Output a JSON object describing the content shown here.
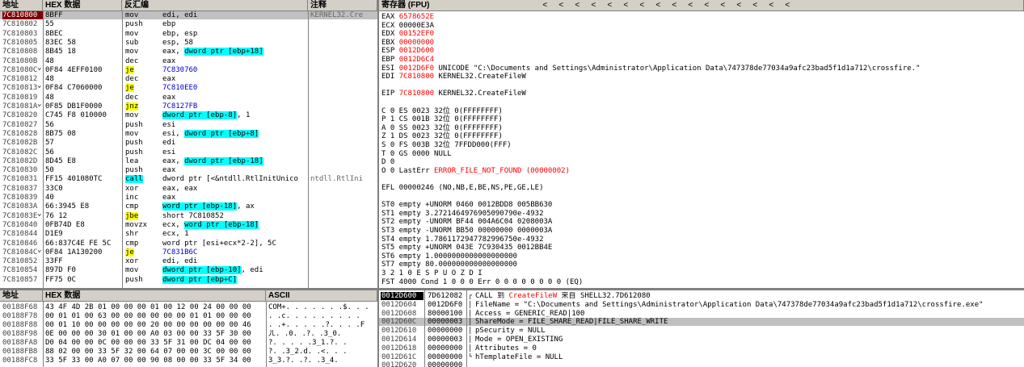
{
  "disasm": {
    "headers": {
      "addr": "地址",
      "hex": "HEX 数据",
      "asm": "反汇编",
      "comment": "注释"
    },
    "rows": [
      {
        "addr": "7C810800",
        "hex": "8BFF",
        "asm": [
          [
            "mov",
            ""
          ],
          [
            "edi, edi",
            ""
          ]
        ],
        "comment": "KERNEL32.Cre",
        "sel": true
      },
      {
        "addr": "7C810802",
        "hex": "55",
        "asm": [
          [
            "push",
            ""
          ],
          [
            "ebp",
            ""
          ]
        ],
        "comment": ""
      },
      {
        "addr": "7C810803",
        "hex": "8BEC",
        "asm": [
          [
            "mov",
            ""
          ],
          [
            "ebp, esp",
            ""
          ]
        ],
        "comment": ""
      },
      {
        "addr": "7C810805",
        "hex": "83EC 58",
        "asm": [
          [
            "sub",
            ""
          ],
          [
            "esp, 58",
            ""
          ]
        ],
        "comment": ""
      },
      {
        "addr": "7C810808",
        "hex": "8B45 18",
        "asm": [
          [
            "mov",
            ""
          ],
          [
            "eax, ",
            ""
          ],
          [
            "dword ptr [ebp+18]",
            "hl"
          ]
        ],
        "comment": ""
      },
      {
        "addr": "7C81080B",
        "hex": "48",
        "asm": [
          [
            "dec",
            ""
          ],
          [
            "eax",
            ""
          ]
        ],
        "comment": ""
      },
      {
        "addr": "7C81080C",
        "hex": "0F84 4EFF0100",
        "asm": [
          [
            "je",
            "yel"
          ],
          [
            "7C830760",
            "blu"
          ]
        ],
        "comment": "",
        "arrow": true
      },
      {
        "addr": "7C810812",
        "hex": "48",
        "asm": [
          [
            "dec",
            ""
          ],
          [
            "eax",
            ""
          ]
        ],
        "comment": ""
      },
      {
        "addr": "7C810813",
        "hex": "0F84 C7060000",
        "asm": [
          [
            "je",
            "yel"
          ],
          [
            "7C810EE0",
            "blu"
          ]
        ],
        "comment": "",
        "arrow": true
      },
      {
        "addr": "7C810819",
        "hex": "48",
        "asm": [
          [
            "dec",
            ""
          ],
          [
            "eax",
            ""
          ]
        ],
        "comment": ""
      },
      {
        "addr": "7C81081A",
        "hex": "0F85 DB1F0000",
        "asm": [
          [
            "jnz",
            "yel"
          ],
          [
            "7C8127FB",
            "blu"
          ]
        ],
        "comment": "",
        "arrow": true
      },
      {
        "addr": "7C810820",
        "hex": "C745 F8 010000",
        "asm": [
          [
            "mov",
            ""
          ],
          [
            "dword ptr [ebp-8]",
            "hl"
          ],
          [
            ", 1",
            ""
          ]
        ],
        "comment": ""
      },
      {
        "addr": "7C810827",
        "hex": "56",
        "asm": [
          [
            "push",
            ""
          ],
          [
            "esi",
            ""
          ]
        ],
        "comment": ""
      },
      {
        "addr": "7C810828",
        "hex": "8B75 08",
        "asm": [
          [
            "mov",
            ""
          ],
          [
            "esi, ",
            ""
          ],
          [
            "dword ptr [ebp+8]",
            "hl"
          ]
        ],
        "comment": ""
      },
      {
        "addr": "7C81082B",
        "hex": "57",
        "asm": [
          [
            "push",
            ""
          ],
          [
            "edi",
            ""
          ]
        ],
        "comment": ""
      },
      {
        "addr": "7C81082C",
        "hex": "56",
        "asm": [
          [
            "push",
            ""
          ],
          [
            "esi",
            ""
          ]
        ],
        "comment": ""
      },
      {
        "addr": "7C81082D",
        "hex": "8D45 E8",
        "asm": [
          [
            "lea",
            ""
          ],
          [
            "eax, ",
            ""
          ],
          [
            "dword ptr [ebp-18]",
            "hl"
          ]
        ],
        "comment": ""
      },
      {
        "addr": "7C810830",
        "hex": "50",
        "asm": [
          [
            "push",
            ""
          ],
          [
            "eax",
            ""
          ]
        ],
        "comment": ""
      },
      {
        "addr": "7C810831",
        "hex": "FF15 401080TC",
        "asm": [
          [
            "call",
            "hl"
          ],
          [
            "dword ptr [<&ntdll.RtlInitUnico",
            ""
          ]
        ],
        "comment": "ntdll.RtlIni"
      },
      {
        "addr": "7C810837",
        "hex": "33C0",
        "asm": [
          [
            "xor",
            ""
          ],
          [
            "eax, eax",
            ""
          ]
        ],
        "comment": ""
      },
      {
        "addr": "7C810839",
        "hex": "40",
        "asm": [
          [
            "inc",
            ""
          ],
          [
            "eax",
            ""
          ]
        ],
        "comment": ""
      },
      {
        "addr": "7C81083A",
        "hex": "66:3945 E8",
        "asm": [
          [
            "cmp",
            ""
          ],
          [
            "word ptr [ebp-18]",
            "hl"
          ],
          [
            ", ax",
            ""
          ]
        ],
        "comment": ""
      },
      {
        "addr": "7C81083E",
        "hex": "76 12",
        "asm": [
          [
            "jbe",
            "yel"
          ],
          [
            "short 7C810852",
            ""
          ]
        ],
        "comment": "",
        "arrow": true
      },
      {
        "addr": "7C810840",
        "hex": "0FB74D E8",
        "asm": [
          [
            "movzx",
            ""
          ],
          [
            "ecx, ",
            ""
          ],
          [
            "word ptr [ebp-18]",
            "hl"
          ]
        ],
        "comment": ""
      },
      {
        "addr": "7C810844",
        "hex": "D1E9",
        "asm": [
          [
            "shr",
            ""
          ],
          [
            "ecx, 1",
            ""
          ]
        ],
        "comment": ""
      },
      {
        "addr": "7C810846",
        "hex": "66:837C4E FE 5C",
        "asm": [
          [
            "cmp",
            ""
          ],
          [
            "word ptr [esi+ecx*2-2], 5C",
            ""
          ]
        ],
        "comment": ""
      },
      {
        "addr": "7C81084C",
        "hex": "0F84 1A130200",
        "asm": [
          [
            "je",
            "yel"
          ],
          [
            "7C831B6C",
            "blu"
          ]
        ],
        "comment": "",
        "arrow": true
      },
      {
        "addr": "7C810852",
        "hex": "33FF",
        "asm": [
          [
            "xor",
            ""
          ],
          [
            "edi, edi",
            ""
          ]
        ],
        "comment": ""
      },
      {
        "addr": "7C810854",
        "hex": "897D F0",
        "asm": [
          [
            "mov",
            ""
          ],
          [
            "dword ptr [ebp-10]",
            "hl"
          ],
          [
            ", edi",
            ""
          ]
        ],
        "comment": ""
      },
      {
        "addr": "7C810857",
        "hex": "FF75 0C",
        "asm": [
          [
            "push",
            ""
          ],
          [
            "dword ptr [ebp+C]",
            "hl"
          ]
        ],
        "comment": ""
      }
    ]
  },
  "registers": {
    "header": "寄存器 (FPU)",
    "arrows": [
      "<",
      "<",
      "<",
      "<",
      "<",
      "<",
      "<",
      "<",
      "<",
      "<",
      "<",
      "<",
      "<",
      "<",
      "<",
      "<"
    ],
    "lines": [
      [
        [
          "EAX ",
          ""
        ],
        [
          "6578652E",
          "red"
        ]
      ],
      [
        [
          "ECX 00000E3A",
          ""
        ]
      ],
      [
        [
          "EDX ",
          ""
        ],
        [
          "00152EF0",
          "red"
        ]
      ],
      [
        [
          "EBX ",
          ""
        ],
        [
          "00000000",
          "red"
        ]
      ],
      [
        [
          "ESP ",
          ""
        ],
        [
          "0012D600",
          "red"
        ]
      ],
      [
        [
          "EBP ",
          ""
        ],
        [
          "0012D6C4",
          "red"
        ]
      ],
      [
        [
          "ESI ",
          ""
        ],
        [
          "0012D6F0",
          "red"
        ],
        [
          " UNICODE \"C:\\Documents and Settings\\Administrator\\Application Data\\747378de77034a9afc23bad5f1d1a712\\crossfire.\"",
          ""
        ]
      ],
      [
        [
          "EDI ",
          ""
        ],
        [
          "7C810800",
          "red"
        ],
        [
          " KERNEL32.CreateFileW",
          ""
        ]
      ],
      [
        [
          "",
          ""
        ]
      ],
      [
        [
          "EIP ",
          ""
        ],
        [
          "7C810800",
          "red"
        ],
        [
          " KERNEL32.CreateFileW",
          ""
        ]
      ],
      [
        [
          "",
          ""
        ]
      ],
      [
        [
          "C 0  ES 0023 32位 0(FFFFFFFF)",
          ""
        ]
      ],
      [
        [
          "P 1  CS 001B 32位 0(FFFFFFFF)",
          ""
        ]
      ],
      [
        [
          "A 0  SS 0023 32位 0(FFFFFFFF)",
          ""
        ]
      ],
      [
        [
          "Z 1  DS 0023 32位 0(FFFFFFFF)",
          ""
        ]
      ],
      [
        [
          "S 0  FS 003B 32位 7FFDD000(FFF)",
          ""
        ]
      ],
      [
        [
          "T 0  GS 0000 NULL",
          ""
        ]
      ],
      [
        [
          "D 0",
          ""
        ]
      ],
      [
        [
          "O 0  LastErr ",
          ""
        ],
        [
          "ERROR_FILE_NOT_FOUND (00000002)",
          "red"
        ]
      ],
      [
        [
          "",
          ""
        ]
      ],
      [
        [
          "EFL 00000246 (NO,NB,E,BE,NS,PE,GE,LE)",
          ""
        ]
      ],
      [
        [
          "",
          ""
        ]
      ],
      [
        [
          "ST0 empty +UNORM 0460 0012BDD8 005BB630",
          ""
        ]
      ],
      [
        [
          "ST1 empty 3.2721464976905090790e-4932",
          ""
        ]
      ],
      [
        [
          "ST2 empty -UNORM BF44 004A6C04 0208003A",
          ""
        ]
      ],
      [
        [
          "ST3 empty -UNORM BB50 00000000 0000003A",
          ""
        ]
      ],
      [
        [
          "ST4 empty 1.7861172947782996750e-4932",
          ""
        ]
      ],
      [
        [
          "ST5 empty +UNORM 043E 7C930435 0012BB4E",
          ""
        ]
      ],
      [
        [
          "ST6 empty 1.0000000000000000000",
          ""
        ]
      ],
      [
        [
          "ST7 empty 80.000000000000000000",
          ""
        ]
      ],
      [
        [
          "               3 2 1 0      E S P U O Z D I",
          ""
        ]
      ],
      [
        [
          "FST 4000  Cond 1 0 0 0  Err 0 0 0 0 0 0 0 0  (EQ)",
          ""
        ]
      ]
    ]
  },
  "dump": {
    "headers": {
      "addr": "地址",
      "hex": "HEX 数据",
      "ascii": "ASCII"
    },
    "rows": [
      {
        "addr": "00188F68",
        "hex": "43 4F 4D 2B 01 00 00 00 01 00 12 00 24 00 00 00",
        "ascii": "COM+. . . . . . .$. . ."
      },
      {
        "addr": "00188F78",
        "hex": "00 01 01 00 63 00 00 00 00 00 00 01 01 00 00 00",
        "ascii": ". .c. . . . . . . . ."
      },
      {
        "addr": "00188F88",
        "hex": "00 01 10 00 00 00 00 00 20 00 00 00 00 00 00 46",
        "ascii": ". .+. . . . .?. . . .F"
      },
      {
        "addr": "00188F98",
        "hex": "0E 00 00 00 30 01 00 00 A0 03 00 00 33 5F 30 00",
        "ascii": "ㄦ. .0. .?. .3_0."
      },
      {
        "addr": "00188FA8",
        "hex": "D0 04 00 00 0C 00 00 00 33 5F 31 00 DC 04 00 00",
        "ascii": "?. . . . .3_1.?. ."
      },
      {
        "addr": "00188FB8",
        "hex": "88 02 00 00 33 5F 32 00 64 07 00 00 3C 00 00 00",
        "ascii": "?. .3_2.d. .<. . ."
      },
      {
        "addr": "00188FC8",
        "hex": "33 5F 33 00 A0 07 00 00 90 08 00 00 33 5F 34 00",
        "ascii": "3_3.?. .?. .3_4."
      }
    ]
  },
  "stack": {
    "rows": [
      {
        "addr": "0012D600",
        "val": "7D612082",
        "text": [
          [
            "CALL 到 ",
            ""
          ],
          [
            "CreateFileW",
            "red"
          ],
          [
            " 来自 SHELL32.7D612080",
            ""
          ]
        ],
        "sel": true,
        "bracket": "top"
      },
      {
        "addr": "0012D604",
        "val": "0012D6F0",
        "text": [
          [
            "FileName = \"C:\\Documents and Settings\\Administrator\\Application Data\\747378de77034a9afc23bad5f1d1a712\\crossfire.exe\"",
            ""
          ]
        ],
        "bracket": "mid"
      },
      {
        "addr": "0012D608",
        "val": "80000100",
        "text": [
          [
            "Access = GENERIC_READ|100",
            ""
          ]
        ],
        "bracket": "mid"
      },
      {
        "addr": "0012D60C",
        "val": "00000003",
        "text": [
          [
            "ShareMode = FILE_SHARE_READ|FILE_SHARE_WRITE",
            ""
          ]
        ],
        "bracket": "mid",
        "hl": true
      },
      {
        "addr": "0012D610",
        "val": "00000000",
        "text": [
          [
            "pSecurity = NULL",
            ""
          ]
        ],
        "bracket": "mid"
      },
      {
        "addr": "0012D614",
        "val": "00000003",
        "text": [
          [
            "Mode = OPEN_EXISTING",
            ""
          ]
        ],
        "bracket": "mid"
      },
      {
        "addr": "0012D618",
        "val": "00000000",
        "text": [
          [
            "Attributes = 0",
            ""
          ]
        ],
        "bracket": "mid"
      },
      {
        "addr": "0012D61C",
        "val": "00000000",
        "text": [
          [
            "hTemplateFile = NULL",
            ""
          ]
        ],
        "bracket": "bot"
      },
      {
        "addr": "0012D620",
        "val": "00000000",
        "text": [
          [
            "",
            ""
          ]
        ]
      }
    ]
  }
}
